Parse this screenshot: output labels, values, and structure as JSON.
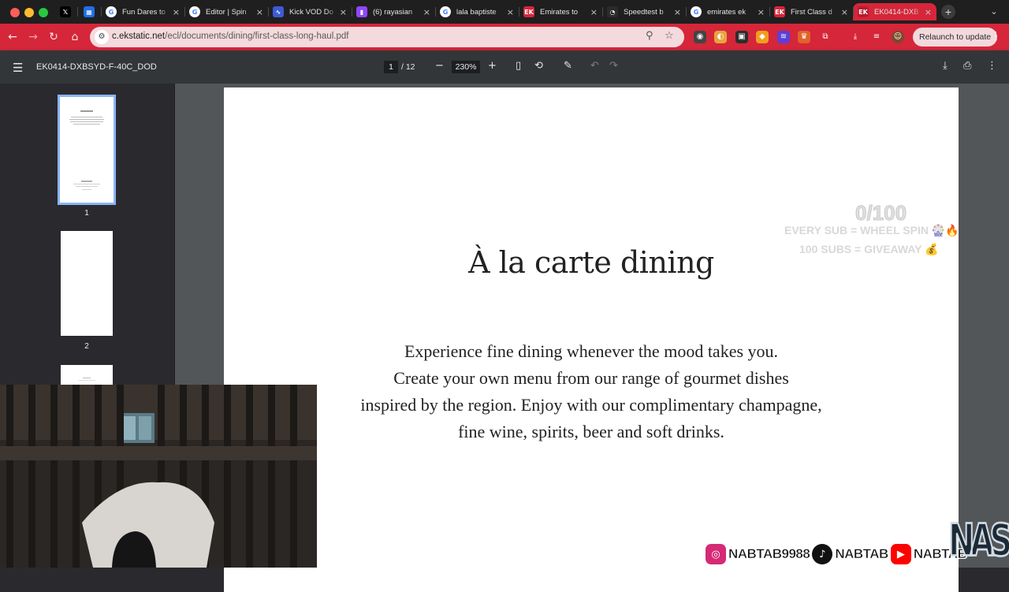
{
  "browser": {
    "tabs": [
      {
        "title": "",
        "icon": "x-logo-icon",
        "color": "#000000",
        "glyph": "𝕏"
      },
      {
        "title": "",
        "icon": "puzzle-app-icon",
        "color": "#1f6feb",
        "glyph": "▦"
      },
      {
        "title": "Fun Dares to",
        "icon": "google-icon",
        "color": "#ffffff",
        "glyph": "G"
      },
      {
        "title": "Editor | Spin",
        "icon": "google-icon",
        "color": "#ffffff",
        "glyph": "G"
      },
      {
        "title": "Kick VOD Do",
        "icon": "download-icon",
        "color": "#3c5bd6",
        "glyph": "∿"
      },
      {
        "title": "(6) rayasian",
        "icon": "twitch-icon",
        "color": "#9146ff",
        "glyph": "▮"
      },
      {
        "title": "lala baptiste",
        "icon": "google-icon",
        "color": "#ffffff",
        "glyph": "G"
      },
      {
        "title": "Emirates to",
        "icon": "emirates-icon",
        "color": "#d5263a",
        "glyph": "EK"
      },
      {
        "title": "Speedtest b",
        "icon": "speedtest-icon",
        "color": "#2b2b2b",
        "glyph": "◔"
      },
      {
        "title": "emirates ek",
        "icon": "google-icon",
        "color": "#ffffff",
        "glyph": "G"
      },
      {
        "title": "First Class d",
        "icon": "emirates-icon",
        "color": "#d5263a",
        "glyph": "EK"
      },
      {
        "title": "EK0414-DXB",
        "icon": "emirates-icon",
        "color": "#b51e30",
        "glyph": "EK",
        "active": true
      }
    ],
    "url_host": "c.ekstatic.net",
    "url_path": "/ecl/documents/dining/first-class-long-haul.pdf",
    "relaunch_label": "Relaunch to update",
    "accent_color": "#d5263a"
  },
  "pdf": {
    "doc_name": "EK0414-DXBSYD-F-40C_DOD",
    "current_page": "1",
    "total_pages": "/ 12",
    "zoom": "230%",
    "thumb_labels": [
      "1",
      "2"
    ],
    "title": "À la carte dining",
    "body_lines": [
      "Experience fine dining whenever the mood takes you.",
      "Create your own menu from our range of gourmet dishes",
      "inspired by the region. Enjoy with our complimentary champagne,",
      "fine wine, spirits, beer and soft drinks."
    ]
  },
  "overlay": {
    "goal_count": "0/100",
    "goal_line1": "EVERY SUB = WHEEL SPIN 🎡🔥",
    "goal_line2": "100 SUBS = GIVEAWAY 💰",
    "instagram": "NABTAB9988",
    "tiktok": "NABTAB",
    "youtube": "NABTAB",
    "logo": "NAS"
  }
}
